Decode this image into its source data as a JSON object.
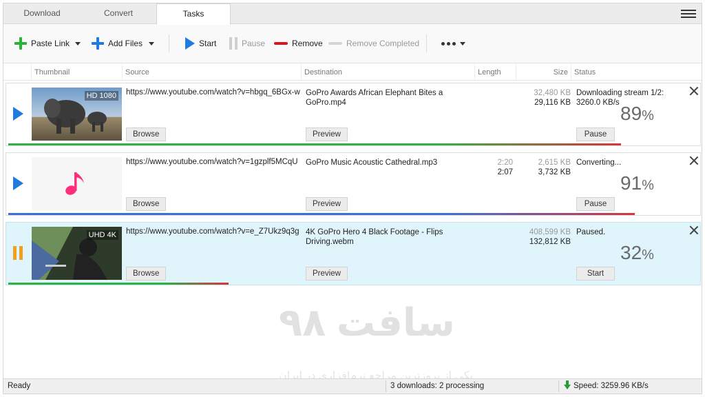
{
  "tabs": [
    {
      "label": "Download",
      "active": false
    },
    {
      "label": "Convert",
      "active": false
    },
    {
      "label": "Tasks",
      "active": true
    }
  ],
  "toolbar": {
    "paste_link": "Paste Link",
    "add_files": "Add Files",
    "start": "Start",
    "pause": "Pause",
    "remove": "Remove",
    "remove_completed": "Remove Completed",
    "more_icon": "more-dots-icon"
  },
  "columns": {
    "thumbnail": "Thumbnail",
    "source": "Source",
    "destination": "Destination",
    "length": "Length",
    "size": "Size",
    "status": "Status"
  },
  "tasks": [
    {
      "state": "playing",
      "thumb_badge": "HD 1080",
      "source": "https://www.youtube.com/watch?v=hbgq_6BGx-w",
      "destination": "GoPro Awards  African Elephant Bites a GoPro.mp4",
      "length_total": "",
      "length_done": "",
      "size_total": "32,480 KB",
      "size_done": "29,116 KB",
      "status": "Downloading stream 1/2: 3260.0 KB/s",
      "percent": "89",
      "progress": 0.89,
      "progress_color": "#33b044",
      "progress_color2": "#d9343a",
      "browse_label": "Browse",
      "preview_label": "Preview",
      "action_label": "Pause"
    },
    {
      "state": "playing",
      "thumb_badge": "",
      "source": "https://www.youtube.com/watch?v=1gzplf5MCqU",
      "destination": "GoPro Music  Acoustic Cathedral.mp3",
      "length_total": "2:20",
      "length_done": "2:07",
      "size_total": "2,615 KB",
      "size_done": "3,732 KB",
      "status": "Converting...",
      "percent": "91",
      "progress": 0.91,
      "progress_color": "#3c6ed8",
      "progress_color2": "#d9343a",
      "browse_label": "Browse",
      "preview_label": "Preview",
      "action_label": "Pause"
    },
    {
      "state": "paused",
      "thumb_badge": "UHD 4K",
      "source": "https://www.youtube.com/watch?v=e_Z7Ukz9q3g",
      "destination": "4K GoPro Hero 4 Black Footage - Flips Driving.webm",
      "length_total": "",
      "length_done": "",
      "size_total": "408,599 KB",
      "size_done": "132,812 KB",
      "status": "Paused.",
      "percent": "32",
      "progress": 0.32,
      "progress_color": "#33b044",
      "progress_color2": "#d9343a",
      "browse_label": "Browse",
      "preview_label": "Preview",
      "action_label": "Start"
    }
  ],
  "percent_sign": "%",
  "statusbar": {
    "ready": "Ready",
    "summary": "3 downloads: 2 processing",
    "speed": "Speed: 3259.96 KB/s"
  },
  "watermark": {
    "title": "سافت ۹۸",
    "subtitle": "یکی از بروزترین مراجع نرم‌افزاری در ایران"
  },
  "colors": {
    "accent_blue": "#1e7be0",
    "add_green": "#2ab33a",
    "remove_red": "#e0141e",
    "pause_orange": "#f0a020",
    "selected_row": "#dff4fb"
  }
}
